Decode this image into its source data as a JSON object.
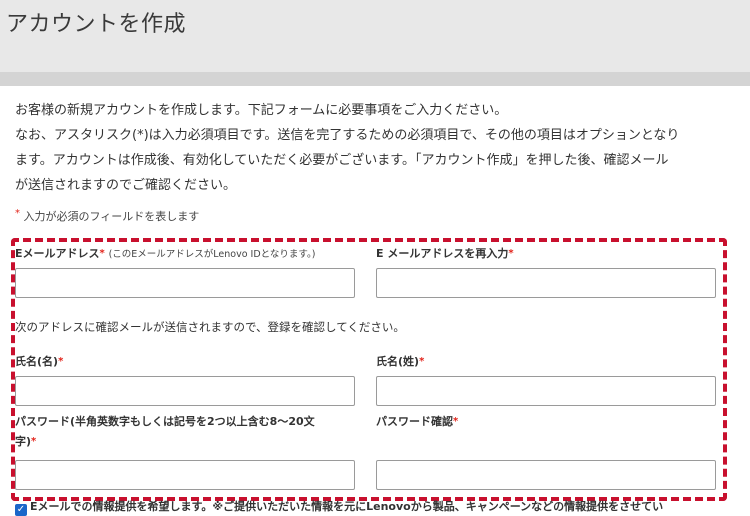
{
  "header": {
    "title": "アカウントを作成"
  },
  "intro": {
    "lines": [
      "お客様の新規アカウントを作成します。下記フォームに必要事項をご入力ください。",
      "なお、アスタリスク(*)は入力必須項目です。送信を完了するための必須項目で、その他の項目はオプションとなり",
      "ます。アカウントは作成後、有効化していただく必要がございます。「アカウント作成」を押した後、確認メール",
      "が送信されますのでご確認ください。"
    ]
  },
  "required_note": {
    "mark": "*",
    "text": "入力が必須のフィールドを表します"
  },
  "form": {
    "email": {
      "label": "Eメールアドレス",
      "star": "*",
      "hint": "(このEメールアドレスがLenovo IDとなります。)",
      "value": ""
    },
    "email_confirm": {
      "label": "E メールアドレスを再入力",
      "star": "*",
      "value": ""
    },
    "confirm_note": "次のアドレスに確認メールが送信されますので、登録を確認してください。",
    "first_name": {
      "label": "氏名(名)",
      "star": "*",
      "value": ""
    },
    "last_name": {
      "label": "氏名(姓)",
      "star": "*",
      "value": ""
    },
    "password": {
      "label_line1": "パスワード(半角英数字もしくは記号を2つ以上含む8～20文",
      "label_line2": "字)",
      "star": "*",
      "value": ""
    },
    "password_confirm": {
      "label": "パスワード確認",
      "star": "*",
      "value": ""
    },
    "opt_in": {
      "checked": true,
      "check_glyph": "✓",
      "text": "Eメールでの情報提供を希望します。※ご提供いただいた情報を元にLenovoから製品、キャンペーンなどの情報提供をさせてい"
    }
  },
  "colors": {
    "header_bg": "#e8e8e8",
    "required_red": "#e2231a",
    "dashed_border": "#c8102e",
    "checkbox_blue": "#1a66c9"
  }
}
